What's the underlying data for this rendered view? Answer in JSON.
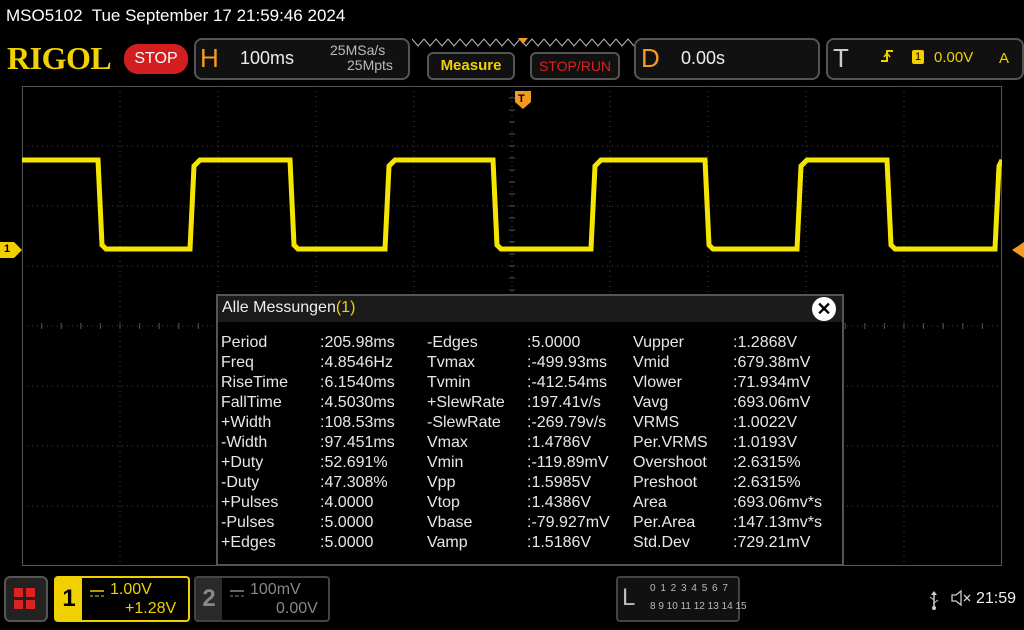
{
  "title_bar": {
    "model": "MSO5102",
    "datetime": "Tue September 17 21:59:46 2024"
  },
  "toolbar": {
    "brand": "RIGOL",
    "run_state": "STOP",
    "horizontal": {
      "letter": "H",
      "timebase": "100ms",
      "sample_rate": "25MSa/s",
      "memory_depth": "25Mpts"
    },
    "measure_label": "Measure",
    "stop_run_label": "STOP/RUN",
    "delay": {
      "letter": "D",
      "value": "0.00s"
    },
    "trigger": {
      "letter": "T",
      "channel": "1",
      "level": "0.00V",
      "mode": "A",
      "edge_icon": "rising-edge-icon"
    }
  },
  "waveform": {
    "channel_marker": "1",
    "trigger_marker": "T",
    "color": "#f5e600"
  },
  "measurements": {
    "title": "Alle Messungen",
    "title_channel": "(1)",
    "close_icon": "close-icon",
    "columns": [
      [
        {
          "name": "Period",
          "value": ":205.98ms"
        },
        {
          "name": "Freq",
          "value": ":4.8546Hz"
        },
        {
          "name": "RiseTime",
          "value": ":6.1540ms"
        },
        {
          "name": "FallTime",
          "value": ":4.5030ms"
        },
        {
          "name": "+Width",
          "value": ":108.53ms"
        },
        {
          "name": "-Width",
          "value": ":97.451ms"
        },
        {
          "name": "+Duty",
          "value": ":52.691%"
        },
        {
          "name": "-Duty",
          "value": ":47.308%"
        },
        {
          "name": "+Pulses",
          "value": ":4.0000"
        },
        {
          "name": "-Pulses",
          "value": ":5.0000"
        },
        {
          "name": "+Edges",
          "value": ":5.0000"
        }
      ],
      [
        {
          "name": "-Edges",
          "value": ":5.0000"
        },
        {
          "name": "Tvmax",
          "value": ":-499.93ms"
        },
        {
          "name": "Tvmin",
          "value": ":-412.54ms"
        },
        {
          "name": "+SlewRate",
          "value": ":197.41v/s"
        },
        {
          "name": "-SlewRate",
          "value": ":-269.79v/s"
        },
        {
          "name": "Vmax",
          "value": ":1.4786V"
        },
        {
          "name": "Vmin",
          "value": ":-119.89mV"
        },
        {
          "name": "Vpp",
          "value": ":1.5985V"
        },
        {
          "name": "Vtop",
          "value": ":1.4386V"
        },
        {
          "name": "Vbase",
          "value": ":-79.927mV"
        },
        {
          "name": "Vamp",
          "value": ":1.5186V"
        }
      ],
      [
        {
          "name": "Vupper",
          "value": ":1.2868V"
        },
        {
          "name": "Vmid",
          "value": ":679.38mV"
        },
        {
          "name": "Vlower",
          "value": ":71.934mV"
        },
        {
          "name": "Vavg",
          "value": ":693.06mV"
        },
        {
          "name": "VRMS",
          "value": ":1.0022V"
        },
        {
          "name": "Per.VRMS",
          "value": ":1.0193V"
        },
        {
          "name": "Overshoot",
          "value": ":2.6315%"
        },
        {
          "name": "Preshoot",
          "value": ":2.6315%"
        },
        {
          "name": "Area",
          "value": ":693.06mv*s"
        },
        {
          "name": "Per.Area",
          "value": ":147.13mv*s"
        },
        {
          "name": "Std.Dev",
          "value": ":729.21mV"
        }
      ]
    ]
  },
  "bottom_bar": {
    "ch1": {
      "number": "1",
      "scale": "1.00V",
      "offset": "+1.28V"
    },
    "ch2": {
      "number": "2",
      "scale": "100mV",
      "offset": "0.00V"
    },
    "la": {
      "letter": "L",
      "row1": "0 1 2 3  4 5 6 7",
      "row2": "8 9 10 11 12 13 14 15"
    },
    "usb_icon": "usb-icon",
    "speaker_icon": "speaker-muted-icon",
    "clock": "21:59"
  }
}
